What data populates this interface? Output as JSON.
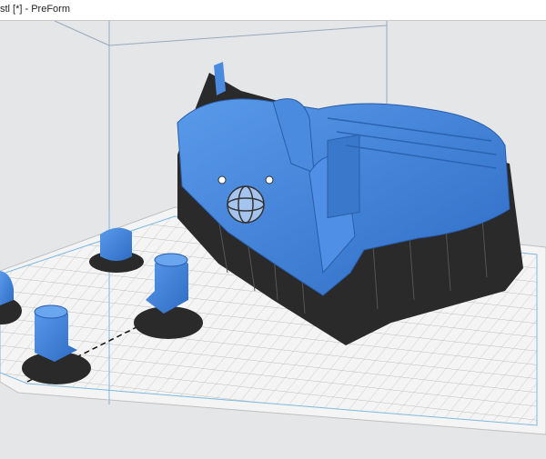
{
  "window": {
    "title": "stl [*] - PreForm"
  },
  "colors": {
    "model": "#3d7fd6",
    "supports": "#2a2a2a",
    "plate": "#ffffff",
    "background": "#e4e6e8",
    "boundary": "#7fb8e0"
  }
}
